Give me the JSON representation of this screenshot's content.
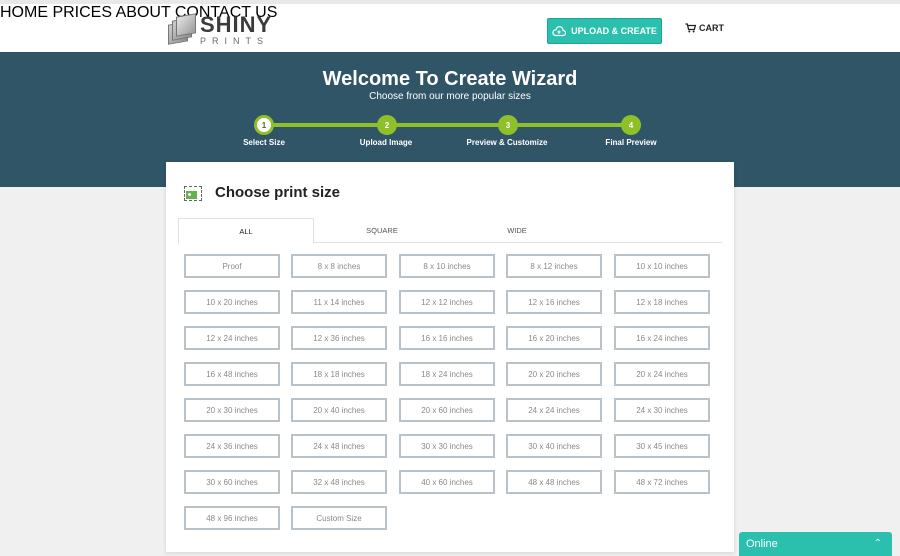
{
  "brand": {
    "line1": "SHINY",
    "line2": "PRINTS"
  },
  "nav": {
    "items": [
      "HOME",
      "PRICES",
      "ABOUT",
      "CONTACT US"
    ],
    "upload_label": "UPLOAD & CREATE",
    "cart_label": "CART"
  },
  "banner": {
    "title": "Welcome To Create Wizard",
    "subtitle": "Choose from our more popular sizes"
  },
  "steps": [
    {
      "number": "1",
      "label": "Select Size",
      "active": true
    },
    {
      "number": "2",
      "label": "Upload Image",
      "active": false
    },
    {
      "number": "3",
      "label": "Preview & Customize",
      "active": false
    },
    {
      "number": "4",
      "label": "Final Preview",
      "active": false
    }
  ],
  "card": {
    "title": "Choose print size"
  },
  "tabs": [
    "ALL",
    "SQUARE",
    "WIDE"
  ],
  "active_tab": "ALL",
  "sizes": [
    "Proof",
    "8 x 8 inches",
    "8 x 10 inches",
    "8 x 12 inches",
    "10 x 10 inches",
    "10 x 20 inches",
    "11 x 14 inches",
    "12 x 12 inches",
    "12 x 16 inches",
    "12 x 18 inches",
    "12 x 24 inches",
    "12 x 36 inches",
    "16 x 16 inches",
    "16 x 20 inches",
    "16 x 24 inches",
    "16 x 48 inches",
    "18 x 18 inches",
    "18 x 24 inches",
    "20 x 20 inches",
    "20 x 24 inches",
    "20 x 30 inches",
    "20 x 40 inches",
    "20 x 60 inches",
    "24 x 24 inches",
    "24 x 30 inches",
    "24 x 36 inches",
    "24 x 48 inches",
    "30 x 30 inches",
    "30 x 40 inches",
    "30 x 45 inches",
    "30 x 60 inches",
    "32 x 48 inches",
    "40 x 60 inches",
    "48 x 48 inches",
    "48 x 72 inches",
    "48 x 96 inches",
    "Custom Size"
  ],
  "chat": {
    "label": "Online"
  },
  "colors": {
    "banner": "#2f5566",
    "accent": "#2bbfae",
    "step_green": "#8fc02a"
  }
}
